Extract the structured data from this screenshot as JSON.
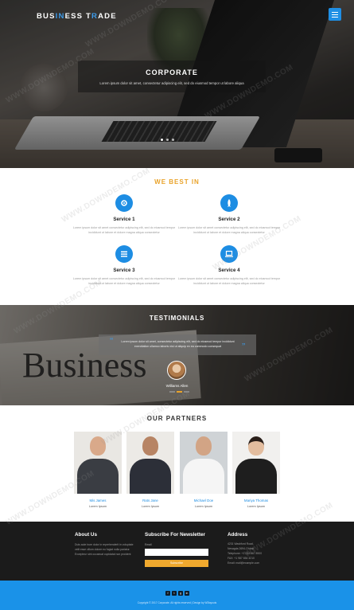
{
  "header": {
    "brand_part1": "BUS",
    "brand_part2": "IN",
    "brand_part3": "ESS T",
    "brand_part4": "R",
    "brand_part5": "ADE",
    "accent_color": "#3d9be9"
  },
  "hero": {
    "title": "CORPORATE",
    "text": "Lorem ipsum dolor sit amet, consectetur adipiscing elit, sed do eiusmod tempor ut labore aliqua"
  },
  "services": {
    "title": "WE BEST IN",
    "items": [
      {
        "name": "Service 1",
        "icon": "settings-icon",
        "text": "Lorem ipsum dolor sit amet consectetur adipiscing elit, sed do eiusmod tempor incididunt ut labore et dolore magna aliqua consectetur"
      },
      {
        "name": "Service 2",
        "icon": "rocket-icon",
        "text": "Lorem ipsum dolor sit amet consectetur adipiscing elit, sed do eiusmod tempor incididunt ut labore et dolore magna aliqua consectetur"
      },
      {
        "name": "Service 3",
        "icon": "list-icon",
        "text": "Lorem ipsum dolor sit amet consectetur adipiscing elit, sed do eiusmod tempor incididunt ut labore et dolore magna aliqua consectetur"
      },
      {
        "name": "Service 4",
        "icon": "laptop-icon",
        "text": "Lorem ipsum dolor sit amet consectetur adipiscing elit, sed do eiusmod tempor incididunt ut labore et dolore magna aliqua consectetur"
      }
    ]
  },
  "testimonials": {
    "title": "TESTIMONIALS",
    "quote": "Lorem ipsum dolor sit amet, consectetur adipiscing elit, sed do eiusmod tempor incididunt exercitation ullamco laboris nisi ut aliquip ex ea commodo consequat",
    "name": "Williams Allen",
    "background_word": "Business"
  },
  "partners": {
    "title": "OUR PARTNERS",
    "items": [
      {
        "name": "Mis James",
        "role": "Lorem Ipsum"
      },
      {
        "name": "Rats Jane",
        "role": "Lorem Ipsum"
      },
      {
        "name": "Michael Doe",
        "role": "Lorem Ipsum"
      },
      {
        "name": "Mariya Thomas",
        "role": "Lorem Ipsum"
      }
    ]
  },
  "footer": {
    "about_title": "About Us",
    "about_text": "Duis aute irure dolor in reprehenderit in voluptate velit esse cillum dolore eu fugiat nulla pariatur. Excepteur sint occaecat cupidatat non proident",
    "newsletter_title": "Subscribe For Newsletter",
    "email_label": "Email",
    "subscribe_label": "Subscribe",
    "address_title": "Address",
    "address_lines": [
      "4231 Washford Road,",
      "Nevagda 2694-Ohhrki",
      "Telephone: +1 234 567 8900",
      "FAX: +1 987 654 3210",
      "Email: mail@example.com"
    ],
    "social_icons": [
      "f",
      "t",
      "g",
      "in"
    ],
    "copyright": "Copyright © 2017 Corporate. All rights reserved | Design by W3layouts"
  },
  "watermark": "WWW.DOWNDEMO.COM"
}
